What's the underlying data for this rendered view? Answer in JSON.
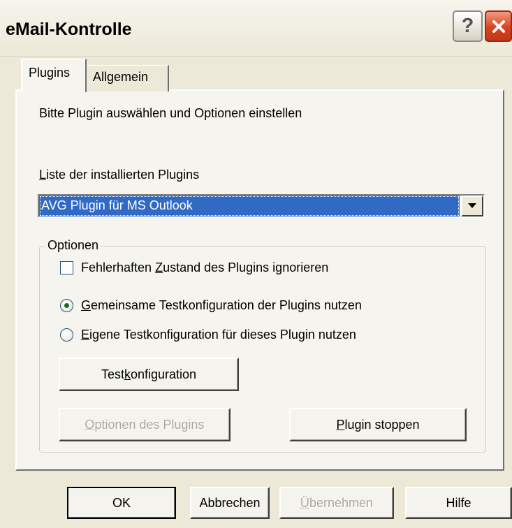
{
  "window": {
    "title": "eMail-Kontrolle",
    "help_label": "?",
    "close_icon": "close-icon"
  },
  "tabs": [
    {
      "label": "Plugins",
      "selected": true
    },
    {
      "label": "Allgemein",
      "selected": false
    }
  ],
  "panel": {
    "instruction": "Bitte Plugin auswählen und Optionen einstellen",
    "list_label_hotkey": "L",
    "list_label_rest": "iste der installierten Plugins",
    "combo_value": "AVG Plugin für MS Outlook"
  },
  "options_group": {
    "legend": "Optionen",
    "checkbox": {
      "before": "Fehlerhaften ",
      "hotkey": "Z",
      "after": "ustand des Plugins ignorieren",
      "checked": false
    },
    "radio_1": {
      "hotkey": "G",
      "rest": "emeinsame Testkonfiguration der Plugins nutzen",
      "selected": true
    },
    "radio_2": {
      "hotkey": "E",
      "rest": "igene Testkonfiguration für dieses Plugin nutzen",
      "selected": false
    },
    "test_config_button": {
      "before": "Test",
      "hotkey": "k",
      "after": "onfiguration"
    },
    "plugin_options_button": {
      "hotkey": "O",
      "rest": "ptionen des Plugins",
      "disabled": true
    },
    "plugin_stop_button": {
      "hotkey": "P",
      "rest": "lugin stoppen"
    }
  },
  "footer": {
    "ok": "OK",
    "cancel": "Abbrechen",
    "apply_hotkey": "Ü",
    "apply_rest": "bernehmen",
    "apply_disabled": true,
    "help": "Hilfe"
  }
}
